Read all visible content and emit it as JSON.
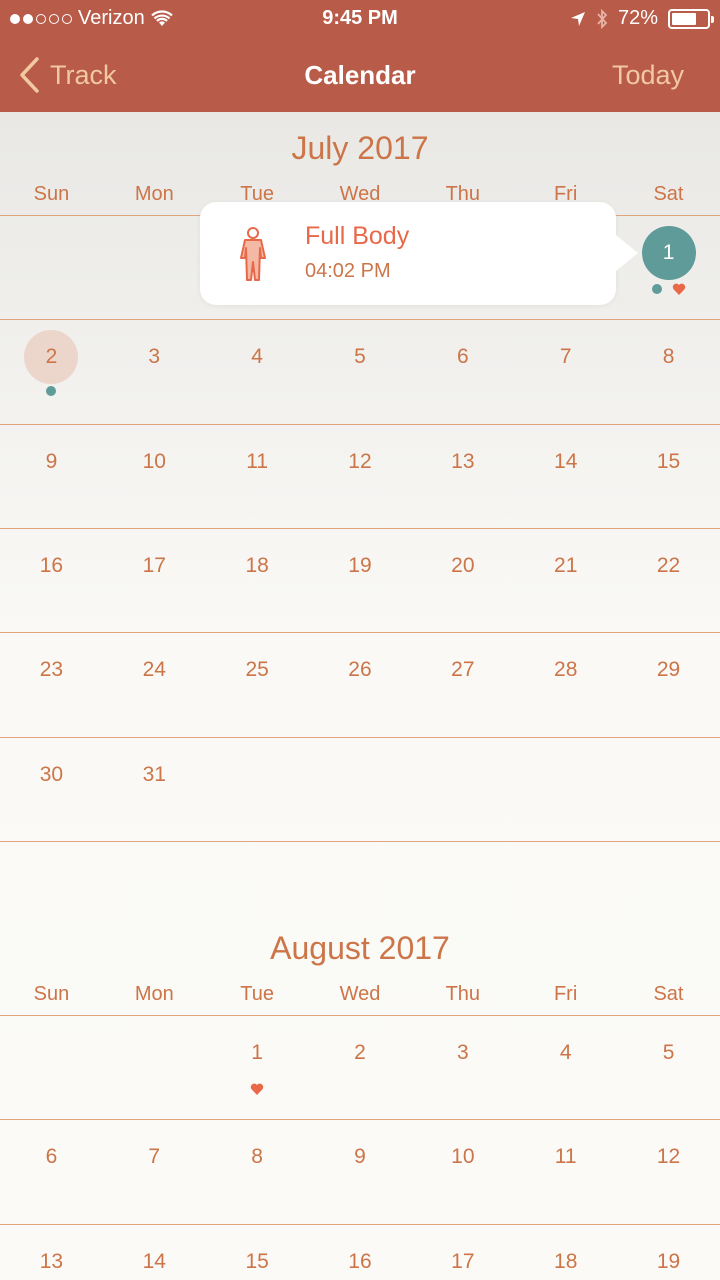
{
  "status_bar": {
    "carrier": "Verizon",
    "time": "9:45 PM",
    "battery": "72%",
    "signal_bars_filled": 2,
    "signal_bars_total": 5,
    "battery_level": 0.72
  },
  "nav": {
    "back_label": "Track",
    "title": "Calendar",
    "today_label": "Today"
  },
  "weekdays": [
    "Sun",
    "Mon",
    "Tue",
    "Wed",
    "Thu",
    "Fri",
    "Sat"
  ],
  "colors": {
    "header": "#b85b48",
    "accent_text": "#cc7548",
    "teal": "#5e9b99",
    "heart": "#e8684a",
    "today_circle": "#ecd6cb"
  },
  "popover": {
    "title": "Full Body",
    "time": "04:02 PM",
    "icon": "full-body-figure-icon"
  },
  "months": [
    {
      "title": "July 2017",
      "weeks": [
        [
          null,
          null,
          null,
          null,
          null,
          null,
          {
            "d": "1",
            "selected": true,
            "dot": true,
            "heart": true
          }
        ],
        [
          {
            "d": "2",
            "today": true,
            "dot": true
          },
          {
            "d": "3"
          },
          {
            "d": "4"
          },
          {
            "d": "5"
          },
          {
            "d": "6"
          },
          {
            "d": "7"
          },
          {
            "d": "8"
          }
        ],
        [
          {
            "d": "9"
          },
          {
            "d": "10"
          },
          {
            "d": "11"
          },
          {
            "d": "12"
          },
          {
            "d": "13"
          },
          {
            "d": "14"
          },
          {
            "d": "15"
          }
        ],
        [
          {
            "d": "16"
          },
          {
            "d": "17"
          },
          {
            "d": "18"
          },
          {
            "d": "19"
          },
          {
            "d": "20"
          },
          {
            "d": "21"
          },
          {
            "d": "22"
          }
        ],
        [
          {
            "d": "23"
          },
          {
            "d": "24"
          },
          {
            "d": "25"
          },
          {
            "d": "26"
          },
          {
            "d": "27"
          },
          {
            "d": "28"
          },
          {
            "d": "29"
          }
        ],
        [
          {
            "d": "30"
          },
          {
            "d": "31"
          },
          null,
          null,
          null,
          null,
          null
        ]
      ]
    },
    {
      "title": "August 2017",
      "weeks": [
        [
          null,
          null,
          {
            "d": "1",
            "heart": true
          },
          {
            "d": "2"
          },
          {
            "d": "3"
          },
          {
            "d": "4"
          },
          {
            "d": "5"
          }
        ],
        [
          {
            "d": "6"
          },
          {
            "d": "7"
          },
          {
            "d": "8"
          },
          {
            "d": "9"
          },
          {
            "d": "10"
          },
          {
            "d": "11"
          },
          {
            "d": "12"
          }
        ],
        [
          {
            "d": "13"
          },
          {
            "d": "14"
          },
          {
            "d": "15"
          },
          {
            "d": "16"
          },
          {
            "d": "17"
          },
          {
            "d": "18"
          },
          {
            "d": "19"
          }
        ]
      ]
    }
  ]
}
